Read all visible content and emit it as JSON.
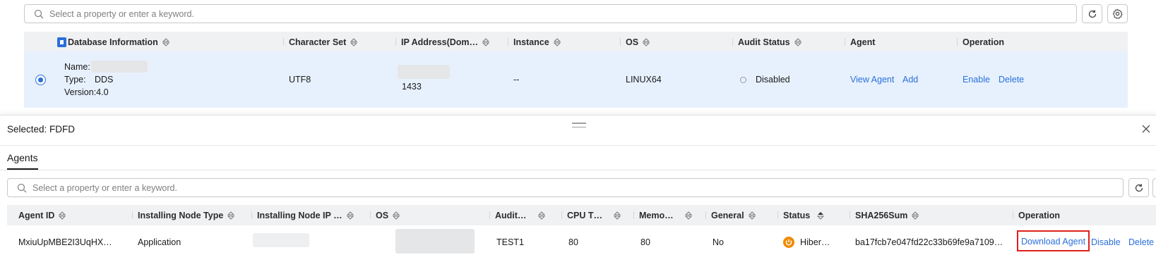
{
  "top": {
    "search_placeholder": "Select a property or enter a keyword.",
    "columns": {
      "db_info": "Database Information",
      "charset": "Character Set",
      "ip": "IP Address(Dom…",
      "instance": "Instance",
      "os": "OS",
      "audit": "Audit Status",
      "agent": "Agent",
      "operation": "Operation"
    },
    "row": {
      "name_label": "Name:",
      "type_label": "Type:",
      "type_value": "DDS",
      "version": "Version:4.0",
      "charset": "UTF8",
      "port": "1433",
      "instance": "--",
      "os": "LINUX64",
      "audit_status": "Disabled",
      "view_agent": "View Agent",
      "add": "Add",
      "enable": "Enable",
      "delete": "Delete"
    }
  },
  "panel": {
    "selected": "Selected: FDFD",
    "tab": "Agents",
    "search_placeholder": "Select a property or enter a keyword.",
    "columns": {
      "agent_id": "Agent ID",
      "node_type": "Installing Node Type",
      "node_ip": "Installing Node IP …",
      "os": "OS",
      "audit": "Audit…",
      "cpu": "CPU T…",
      "memory": "Memo…",
      "general": "General",
      "status": "Status",
      "sha": "SHA256Sum",
      "operation": "Operation"
    },
    "row": {
      "agent_id": "MxiuUpMBE2I3UqHX…",
      "node_type": "Application",
      "audit": "TEST1",
      "cpu": "80",
      "memory": "80",
      "general": "No",
      "status": "Hiber…",
      "sha": "ba17fcb7e047fd22c33b69fe9a7109…",
      "download": "Download Agent",
      "disable": "Disable",
      "delete": "Delete"
    }
  },
  "colors": {
    "link": "#2a6fdb",
    "selected_row": "#e7f1fd",
    "header_bg": "#f0f1f3",
    "status_hibernate": "#f08a00",
    "highlight_border": "#e0201c"
  }
}
